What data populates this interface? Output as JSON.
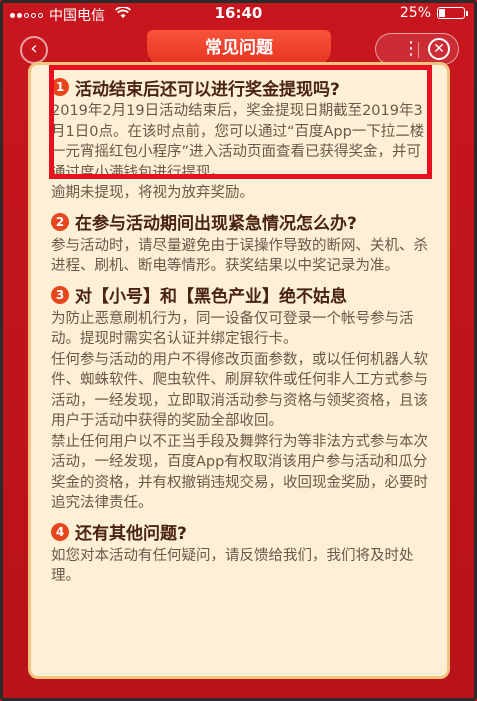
{
  "status_bar": {
    "carrier": "中国电信",
    "time": "16:40",
    "battery_percent": "25%",
    "battery_level": 0.25,
    "signal_bars_filled": 2,
    "signal_bars_total": 5
  },
  "header": {
    "title": "常见问题",
    "back_icon": "chevron-left-icon",
    "more_icon": "more-icon",
    "close_icon": "close-icon"
  },
  "faq": [
    {
      "number": "1",
      "question": "活动结束后还可以进行奖金提现吗?",
      "paragraphs": [
        "2019年2月19日活动结束后，奖金提现日期截至2019年3月1日0点。在该时点前，您可以通过“百度App一下拉二楼一元宵摇红包小程序”进入活动页面查看已获得奖金，并可通过度小满钱包进行提现。",
        "逾期未提现，将视为放弃奖励。"
      ]
    },
    {
      "number": "2",
      "question": "在参与活动期间出现紧急情况怎么办?",
      "paragraphs": [
        "参与活动时，请尽量避免由于误操作导致的断网、关机、杀进程、刷机、断电等情形。获奖结果以中奖记录为准。"
      ]
    },
    {
      "number": "3",
      "question": "对【小号】和【黑色产业】绝不姑息",
      "paragraphs": [
        "为防止恶意刷机行为，同一设备仅可登录一个帐号参与活动。提现时需实名认证并绑定银行卡。",
        "任何参与活动的用户不得修改页面参数，或以任何机器人软件、蜘蛛软件、爬虫软件、刷屏软件或任何非人工方式参与活动，一经发现，立即取消活动参与资格与领奖资格，且该用户于活动中获得的奖励全部收回。",
        "禁止任何用户以不正当手段及舞弊行为等非法方式参与本次活动，一经发现，百度App有权取消该用户参与活动和瓜分奖金的资格，并有权撤销违规交易，收回现金奖励，必要时追究法律责任。"
      ]
    },
    {
      "number": "4",
      "question": "还有其他问题?",
      "paragraphs": [
        "如您对本活动有任何疑问，请反馈给我们，我们将及时处理。"
      ]
    }
  ],
  "colors": {
    "background_red": "#c0141c",
    "card_bg": "#fdf0d6",
    "card_border": "#f3c47d",
    "heading": "#4a2410",
    "body_text": "#6b5848",
    "number_badge": "#e8471e",
    "highlight_box": "#e81020"
  }
}
